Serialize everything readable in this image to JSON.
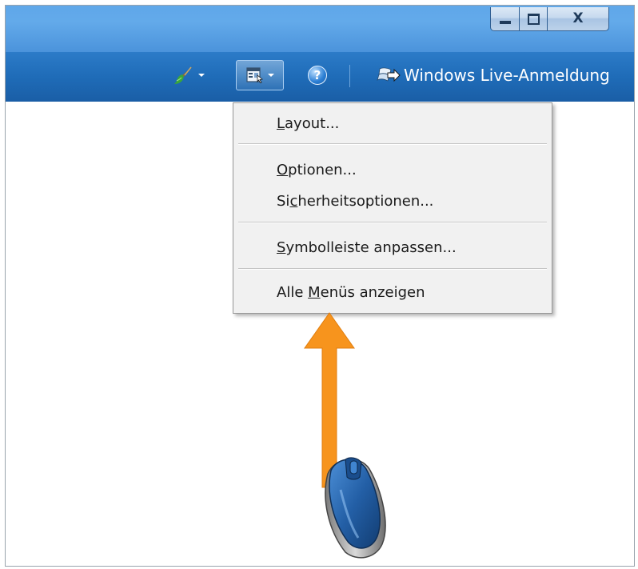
{
  "window": {
    "controls": {
      "minimize_icon": "minimize-icon",
      "maximize_icon": "maximize-icon",
      "close_label": "X"
    }
  },
  "toolbar": {
    "paint_icon": "paintbrush-icon",
    "layout_icon": "layout-icon",
    "help_label": "?",
    "live_icon": "windows-live-icon",
    "signin_label": "Windows Live-Anmeldung"
  },
  "menu": {
    "items": [
      {
        "label_pre": "",
        "accel": "L",
        "label_post": "ayout..."
      },
      {
        "label_pre": "",
        "accel": "O",
        "label_post": "ptionen..."
      },
      {
        "label_pre": "Si",
        "accel": "c",
        "label_post": "herheitsoptionen..."
      },
      {
        "label_pre": "",
        "accel": "S",
        "label_post": "ymbolleiste anpassen..."
      },
      {
        "label_pre": "Alle ",
        "accel": "M",
        "label_post": "enüs anzeigen"
      }
    ]
  },
  "colors": {
    "titlebar": "#5fa7e9",
    "toolbar": "#1f6cb8",
    "menu_bg": "#f1f1f1",
    "arrow": "#f7941d",
    "mouse": "#2a66b0"
  },
  "overlay": {
    "arrow_icon": "orange-arrow-up-icon",
    "mouse_icon": "computer-mouse-icon"
  }
}
